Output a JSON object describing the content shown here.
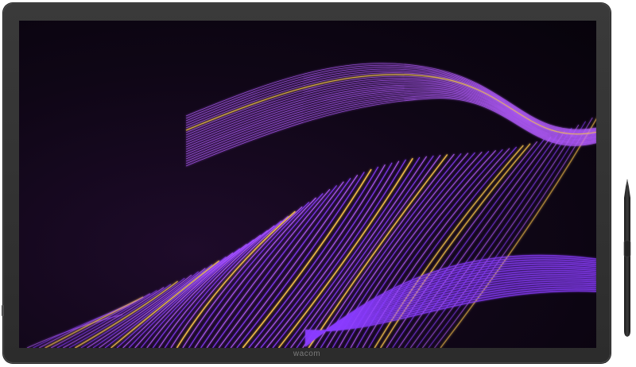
{
  "device": {
    "brand_label": "wacom",
    "bezel_color": "#2e2e2e",
    "screen_background": "#0f0616"
  },
  "artwork": {
    "palette": {
      "primary": "#8a3cff",
      "secondary": "#b45cff",
      "accent": "#f5c04a"
    }
  },
  "stylus": {
    "icon": "pen-icon",
    "color": "#2a2a2a"
  }
}
